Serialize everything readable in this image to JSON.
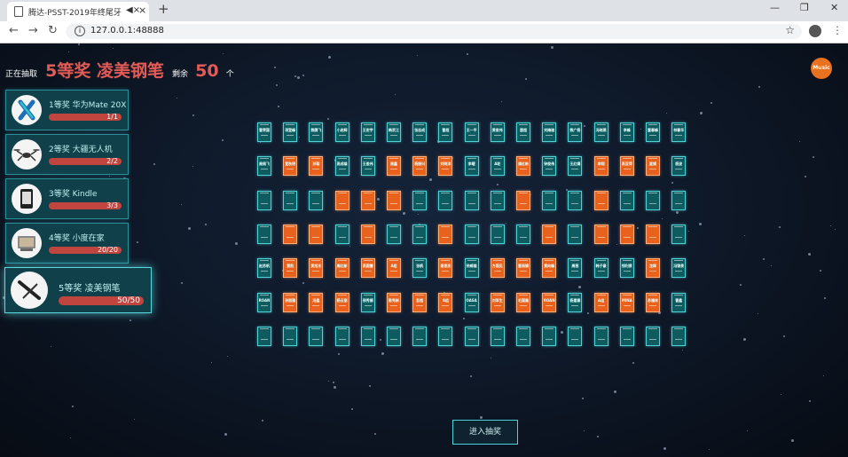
{
  "browser": {
    "tab_title": "腾达-PSST-2019年终尾牙",
    "url": "127.0.0.1:48888"
  },
  "header": {
    "prefix": "正在抽取",
    "current_prize": "5等奖 凌美钢笔",
    "remain_label": "剩余",
    "remain_count": "50",
    "unit": "个"
  },
  "music_label": "Music",
  "prizes": [
    {
      "name": "1等奖 华为Mate 20X",
      "progress": "1/1",
      "fraction": 1
    },
    {
      "name": "2等奖 大疆无人机",
      "progress": "2/2",
      "fraction": 1
    },
    {
      "name": "3等奖 Kindle",
      "progress": "3/3",
      "fraction": 1
    },
    {
      "name": "4等奖 小度在家",
      "progress": "20/20",
      "fraction": 1
    },
    {
      "name": "5等奖 凌美钢笔",
      "progress": "50/50",
      "fraction": 1
    }
  ],
  "card_grid": {
    "rows": [
      {
        "names": [
          "曹荣国",
          "项登峰",
          "熊腾飞",
          "小启辉",
          "王宏宇",
          "韩武江",
          "张志成",
          "曹超",
          "王一平",
          "黄俊伟",
          "唐超",
          "刘梅驰",
          "熊广杨",
          "冯晓燕",
          "李峰",
          "董春峰",
          "林春华"
        ],
        "highlight": [
          0,
          0,
          0,
          0,
          0,
          0,
          0,
          0,
          0,
          0,
          0,
          0,
          0,
          0,
          0,
          0,
          0
        ]
      },
      {
        "names": [
          "周佩飞",
          "宣秋明",
          "孙聪",
          "高成雄",
          "王俊伟",
          "周鑫",
          "杨振兴",
          "刘晓洋",
          "李曜",
          "A轮",
          "谭红新",
          "钟俊伟",
          "王红娟",
          "李翔",
          "高亚萍",
          "夏娟",
          "杨波"
        ],
        "highlight": [
          0,
          1,
          1,
          0,
          0,
          1,
          1,
          1,
          0,
          0,
          1,
          0,
          0,
          1,
          1,
          1,
          0
        ]
      },
      {
        "names": [
          "",
          "",
          "",
          "",
          "",
          "",
          "",
          "",
          "",
          "",
          "",
          "",
          "",
          "",
          "",
          "",
          ""
        ],
        "highlight": [
          0,
          0,
          0,
          1,
          1,
          1,
          0,
          0,
          0,
          0,
          1,
          0,
          0,
          1,
          0,
          0,
          0
        ]
      },
      {
        "names": [
          "",
          "",
          "",
          "",
          "",
          "",
          "",
          "",
          "",
          "",
          "",
          "",
          "",
          "",
          "",
          "",
          ""
        ],
        "highlight": [
          0,
          1,
          1,
          0,
          1,
          0,
          0,
          1,
          0,
          0,
          0,
          1,
          0,
          1,
          1,
          1,
          0
        ]
      },
      {
        "names": [
          "赵苏帆",
          "黄凯",
          "黄旭东",
          "周红新",
          "高国雷",
          "A组",
          "张帆",
          "谢思民",
          "钟威雄",
          "方国见",
          "曹雨娟",
          "黄向峰",
          "周茜",
          "韩子豪",
          "钱利泉",
          "龙辉",
          "冯锦泉"
        ],
        "highlight": [
          0,
          1,
          1,
          1,
          1,
          1,
          0,
          1,
          0,
          1,
          1,
          1,
          0,
          0,
          0,
          1,
          0
        ]
      },
      {
        "names": [
          "ROAN",
          "孙丽雅",
          "冯鑫",
          "杨云丽",
          "邢秀娟",
          "陈秀新",
          "彭超",
          "A组",
          "OASA",
          "刘军生",
          "毛国磊",
          "ROAN",
          "杨建春",
          "A组",
          "MINA",
          "苏福林",
          "曹鑫"
        ],
        "highlight": [
          0,
          1,
          1,
          1,
          0,
          1,
          1,
          1,
          0,
          1,
          1,
          1,
          0,
          1,
          1,
          1,
          0
        ]
      },
      {
        "names": [
          "",
          "",
          "",
          "",
          "",
          "",
          "",
          "",
          "",
          "",
          "",
          "",
          "",
          "",
          "",
          "",
          ""
        ],
        "highlight": [
          0,
          0,
          0,
          0,
          0,
          0,
          0,
          0,
          0,
          0,
          0,
          0,
          0,
          0,
          0,
          0,
          0
        ]
      }
    ]
  },
  "enter_button": "进入抽奖",
  "colors": {
    "accent": "#e25b56",
    "card_teal": "#0f5c60",
    "card_orange": "#e8621d"
  }
}
